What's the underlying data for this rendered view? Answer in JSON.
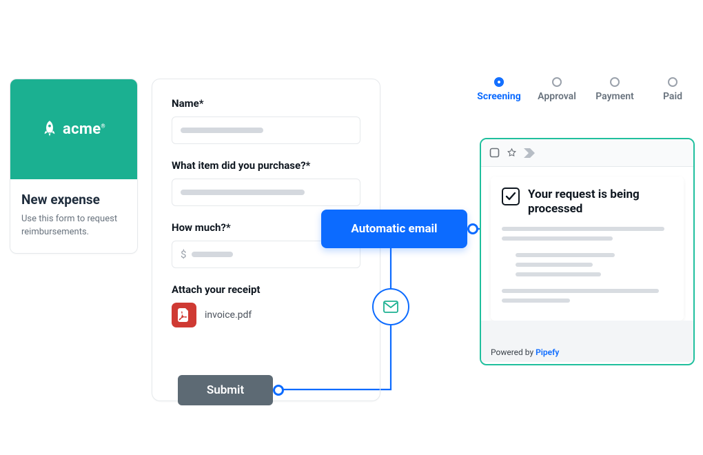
{
  "colors": {
    "accent": "#0c6bff",
    "brand": "#1bb091",
    "danger": "#cf3a33"
  },
  "brand": {
    "name": "acme",
    "logo_alt": "rocket-icon"
  },
  "left_card": {
    "title": "New expense",
    "description": "Use this form to request reimbursements."
  },
  "form": {
    "fields": {
      "name": {
        "label": "Name*"
      },
      "item": {
        "label": "What item did you purchase?*"
      },
      "amount": {
        "label": "How much?*",
        "currency_symbol": "$"
      },
      "receipt": {
        "label": "Attach your receipt",
        "file_name": "invoice.pdf"
      }
    },
    "submit_label": "Submit"
  },
  "automation": {
    "pill_label": "Automatic email"
  },
  "stepper": {
    "steps": [
      "Screening",
      "Approval",
      "Payment",
      "Paid"
    ],
    "active_index": 0
  },
  "email_preview": {
    "message": "Your request is being processed",
    "powered_by_prefix": "Powered by ",
    "powered_by_brand": "Pipefy"
  }
}
